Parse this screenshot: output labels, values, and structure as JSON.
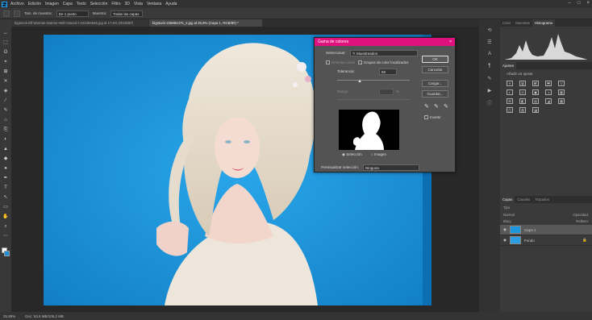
{
  "menu": {
    "ps_logo": "Ps",
    "items": [
      "Archivo",
      "Edición",
      "Imagen",
      "Capa",
      "Texto",
      "Selección",
      "Filtro",
      "3D",
      "Vista",
      "Ventana",
      "Ayuda"
    ],
    "window_controls": [
      "–",
      "□",
      "×"
    ]
  },
  "options": {
    "sample_size_label": "Tam. de muestra:",
    "sample_size_value": "De 1 punto",
    "sample_label": "Muestra:",
    "sample_value": "Todas las capas"
  },
  "doc_tabs": [
    {
      "label": "bigstock-Elf-Woman-Warrior-With-Sword-I-222484546.jpg al 17,6% (RGB/8#)",
      "active": false
    },
    {
      "label": "bigstock-226884475_2.jpg al 25,9% (Capa 1, RGB/8#) *",
      "active": true
    }
  ],
  "tools": [
    "↔",
    "⬚",
    "ʘ",
    "⌖",
    "⊞",
    "✕",
    "◈",
    "⁄",
    "✎",
    "⌂",
    "⎘",
    "◐",
    "▲",
    "◆",
    "●",
    "✒",
    "T",
    "↖",
    "▭",
    "✋",
    "⌕",
    "⋯"
  ],
  "status": {
    "zoom": "25,89%",
    "doc_size": "Doc: 53,6 MB/105,2 MB"
  },
  "right_panels": {
    "tabs_top": [
      "Color",
      "Muestras",
      "Histograma"
    ],
    "tabs_adjust": [
      "Ajustes"
    ],
    "adjust_hint": "Añadir un ajuste",
    "adjust_icons": [
      "☀",
      "▥",
      "◩",
      "⬒",
      "▽",
      "◐",
      "⚖",
      "▣",
      "◑",
      "▦",
      "⊞",
      "◧",
      "▤",
      "◢",
      "▩",
      "◫",
      "▨",
      "◪"
    ],
    "tabs_layers": [
      "Capas",
      "Canales",
      "Trazados"
    ],
    "layer_kind": "Tipo",
    "layer_mode": "Normal",
    "opacity_label": "Opacidad:",
    "fill_label": "Relleno:",
    "lock_label": "Bloq.:",
    "layers": [
      {
        "name": "Capa 1",
        "selected": true
      },
      {
        "name": "Fondo",
        "selected": false
      }
    ]
  },
  "dialog": {
    "title": "Gama de colores",
    "close": "×",
    "select_label": "Seleccionar:",
    "select_value": "Muestreados",
    "detect_faces": "Detectar caras",
    "localized_clusters": "Grupos de color localizados",
    "tolerance_label": "Tolerancia:",
    "tolerance_value": "69",
    "range_label": "Rango:",
    "range_unit": "%",
    "radio_selection": "Selección",
    "radio_image": "Imagen",
    "preview_label": "Previsualizar selección:",
    "preview_value": "Ninguna",
    "buttons": {
      "ok": "OK",
      "cancel": "Cancelar",
      "load": "Cargar...",
      "save": "Guardar..."
    },
    "invert_label": "Invertir",
    "accent": "#e0117f"
  },
  "colors": {
    "canvas_bg": "#1e96dc",
    "dialog_title_bg": "#e0117f"
  }
}
